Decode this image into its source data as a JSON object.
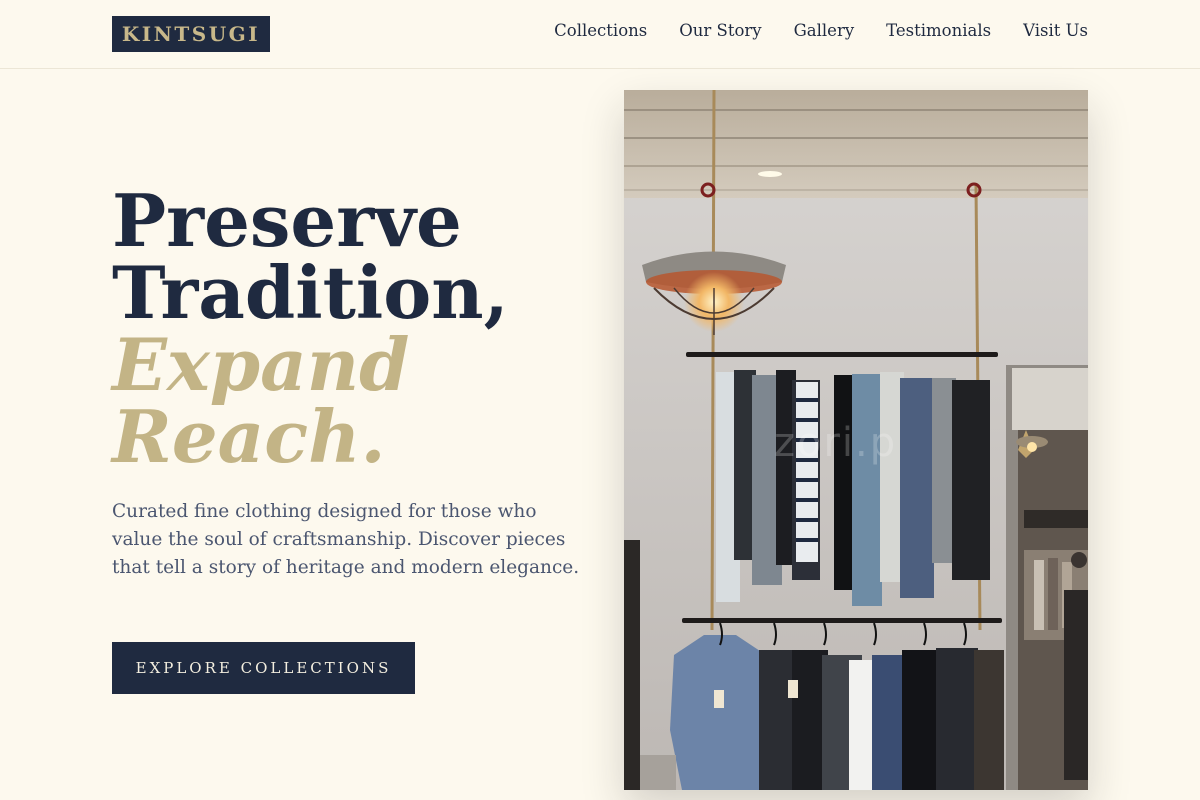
{
  "brand": {
    "logo": "KINTSUGI"
  },
  "nav": {
    "items": [
      "Collections",
      "Our Story",
      "Gallery",
      "Testimonials",
      "Visit Us"
    ]
  },
  "hero": {
    "title_line1": "Preserve",
    "title_line2": "Tradition,",
    "accent_line1": "Expand",
    "accent_line2": "Reach.",
    "description": "Curated fine clothing designed for those who value the soul of craftsmanship. Discover pieces that tell a story of heritage and modern elegance.",
    "cta_label": "EXPLORE COLLECTIONS",
    "image_watermark": "zori.p"
  },
  "colors": {
    "background": "#fdf9ee",
    "navy": "#1f2a40",
    "gold": "#c3b486",
    "body_text": "#4b5670"
  }
}
